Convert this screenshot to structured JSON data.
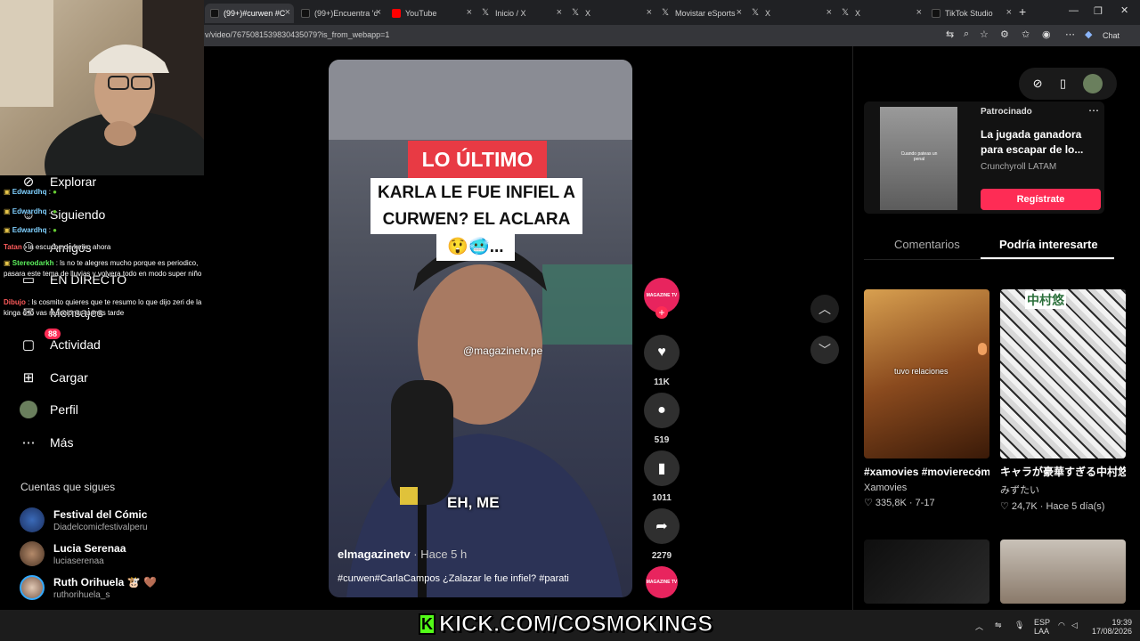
{
  "browser": {
    "tabs": [
      {
        "label": "(99+)#curwen #C",
        "icon": "tiktok-icon",
        "active": true
      },
      {
        "label": "(99+)Encuentra 'c",
        "icon": "tiktok-icon"
      },
      {
        "label": "YouTube",
        "icon": "youtube-icon"
      },
      {
        "label": "Inicio / X",
        "icon": "x-icon"
      },
      {
        "label": "X",
        "icon": "x-icon"
      },
      {
        "label": "Movistar eSports",
        "icon": "x-icon"
      },
      {
        "label": "X",
        "icon": "x-icon"
      },
      {
        "label": "X",
        "icon": "x-icon"
      },
      {
        "label": "TikTok Studio",
        "icon": "tiktok-icon"
      }
    ],
    "url": "v/video/7675081539830435079?is_from_webapp=1",
    "chat_button": "Chat"
  },
  "sidebar": {
    "nav": [
      {
        "label": "Explorar",
        "icon": "compass-icon"
      },
      {
        "label": "Siguiendo",
        "icon": "following-icon"
      },
      {
        "label": "Amigos",
        "icon": "friends-icon"
      },
      {
        "label": "EN DIRECTO",
        "icon": "live-icon"
      },
      {
        "label": "Mensajes",
        "icon": "messages-icon"
      },
      {
        "label": "Actividad",
        "icon": "activity-icon",
        "badge": "88"
      },
      {
        "label": "Cargar",
        "icon": "upload-icon"
      },
      {
        "label": "Perfil",
        "icon": "profile-avatar"
      },
      {
        "label": "Más",
        "icon": "more-icon"
      }
    ],
    "following_title": "Cuentas que sigues",
    "accounts": [
      {
        "name": "Festival del Cómic",
        "handle": "Diadelcomicfestivalperu"
      },
      {
        "name": "Lucia Serenaa",
        "handle": "luciaserenaa"
      },
      {
        "name": "Ruth Orihuela 🐮 🤎",
        "handle": "ruthorihuela_s"
      }
    ]
  },
  "chat": [
    {
      "user": "Edwardhq",
      "text": ":"
    },
    {
      "user": "Edwardhq",
      "text": ":"
    },
    {
      "user": "Edwardhq",
      "text": ":"
    },
    {
      "user": "Tatan",
      "text": ": la escuche de keiko ahora"
    },
    {
      "user": "Stereodarkh",
      "text": ": ls no te alegres mucho porque es periodico, pasara este tema de lluvias y volvera todo en modo super niño"
    },
    {
      "user": "Dibujo",
      "text": ": ls cosmito quieres que te resumo lo que dijo zeri de la kinga o lo vas reaccionar tu mas tarde"
    }
  ],
  "video": {
    "tag": "LO ÚLTIMO",
    "headline_1": "KARLA LE FUE INFIEL A",
    "headline_2": "CURWEN? EL ACLARA",
    "headline_3": "😲🥶...",
    "watermark": "@magazinetv.pe",
    "subtitle": "EH, ME",
    "author": "elmagazinetv",
    "time": " · Hace 5 h",
    "caption": "#curwen#CarlaCampos  ¿Zalazar le fue infiel? #parati",
    "profile_label": "MAGAZINE TV"
  },
  "actions": [
    {
      "icon": "heart-icon",
      "count": "11K"
    },
    {
      "icon": "comment-icon",
      "count": "519"
    },
    {
      "icon": "bookmark-icon",
      "count": "1011"
    },
    {
      "icon": "share-icon",
      "count": "2279"
    }
  ],
  "ad": {
    "sponsor": "Patrocinado",
    "title": "La jugada ganadora para escapar de lo...",
    "brand": "Crunchyroll LATAM",
    "cta": "Regístrate",
    "thumb_text": "Cuando pateas un penal"
  },
  "right_tabs": {
    "comments": "Comentarios",
    "related": "Podría interesarte"
  },
  "related": [
    {
      "title": "#xamovies #movierecommend...",
      "author": "Xamovies",
      "stats": "♡ 335,8K · 7-17",
      "overlay": "tuvo relaciones"
    },
    {
      "title": "キャラが豪華すぎる中村悠一さん✨#一発...",
      "author": "みずたい",
      "stats": "♡ 24,7K · Hace 5 día(s)",
      "overlay": "中村悠"
    }
  ],
  "stream": {
    "kick_banner": "KICK.COM/COSMOKINGS"
  },
  "taskbar": {
    "lang": "ESP",
    "lang2": "LAA",
    "time": "19:39",
    "date": "17/08/2026"
  }
}
